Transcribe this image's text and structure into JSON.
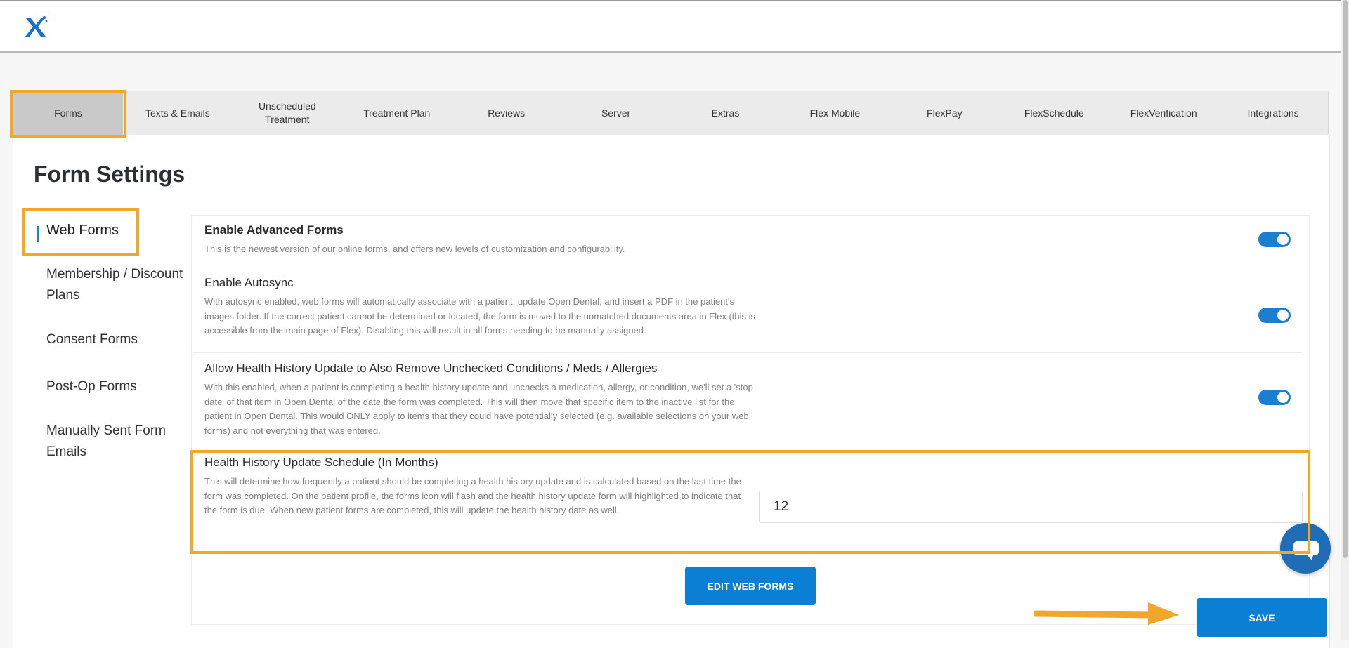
{
  "app": {
    "logo_icon": "x-logo-icon",
    "accent_color": "#0a7fd4",
    "highlight_color": "#f2a72b"
  },
  "tabs": [
    {
      "label": "Forms",
      "active": true
    },
    {
      "label": "Texts & Emails"
    },
    {
      "label": "Unscheduled\nTreatment"
    },
    {
      "label": "Treatment Plan"
    },
    {
      "label": "Reviews"
    },
    {
      "label": "Server"
    },
    {
      "label": "Extras"
    },
    {
      "label": "Flex Mobile"
    },
    {
      "label": "FlexPay"
    },
    {
      "label": "FlexSchedule"
    },
    {
      "label": "FlexVerification"
    },
    {
      "label": "Integrations"
    }
  ],
  "page": {
    "title": "Form Settings"
  },
  "sidebar": {
    "items": [
      {
        "label": "Web Forms",
        "active": true
      },
      {
        "label": "Membership / Discount Plans"
      },
      {
        "label": "Consent Forms"
      },
      {
        "label": "Post-Op Forms"
      },
      {
        "label": "Manually Sent Form Emails"
      }
    ]
  },
  "settings": [
    {
      "title": "Enable Advanced Forms",
      "description": "This is the newest version of our online forms, and offers new levels of customization and configurability.",
      "enabled": true
    },
    {
      "title": "Enable Autosync",
      "description": "With autosync enabled, web forms will automatically associate with a patient, update Open Dental, and insert a PDF in the patient's images folder. If the correct patient cannot be determined or located, the form is moved to the unmatched documents area in Flex (this is accessible from the main page of Flex). Disabling this will result in all forms needing to be manually assigned.",
      "enabled": true
    },
    {
      "title": "Allow Health History Update to Also Remove Unchecked Conditions / Meds / Allergies",
      "description": "With this enabled, when a patient is completing a health history update and unchecks a medication, allergy, or condition, we'll set a 'stop date' of that item in Open Dental of the date the form was completed. This will then move that specific item to the inactive list for the patient in Open Dental. This would ONLY apply to items that they could have potentially selected (e.g. available selections on your web forms) and not everything that was entered.",
      "enabled": true
    },
    {
      "title": "Health History Update Schedule (In Months)",
      "description": "This will determine how frequently a patient should be completing a health history update and is calculated based on the last time the form was completed. On the patient profile, the forms icon will flash and the health history update form will highlighted to indicate that the form is due. When new patient forms are completed, this will update the health history date as well.",
      "value": "12"
    }
  ],
  "buttons": {
    "edit_web_forms": "EDIT WEB FORMS",
    "save": "SAVE"
  }
}
